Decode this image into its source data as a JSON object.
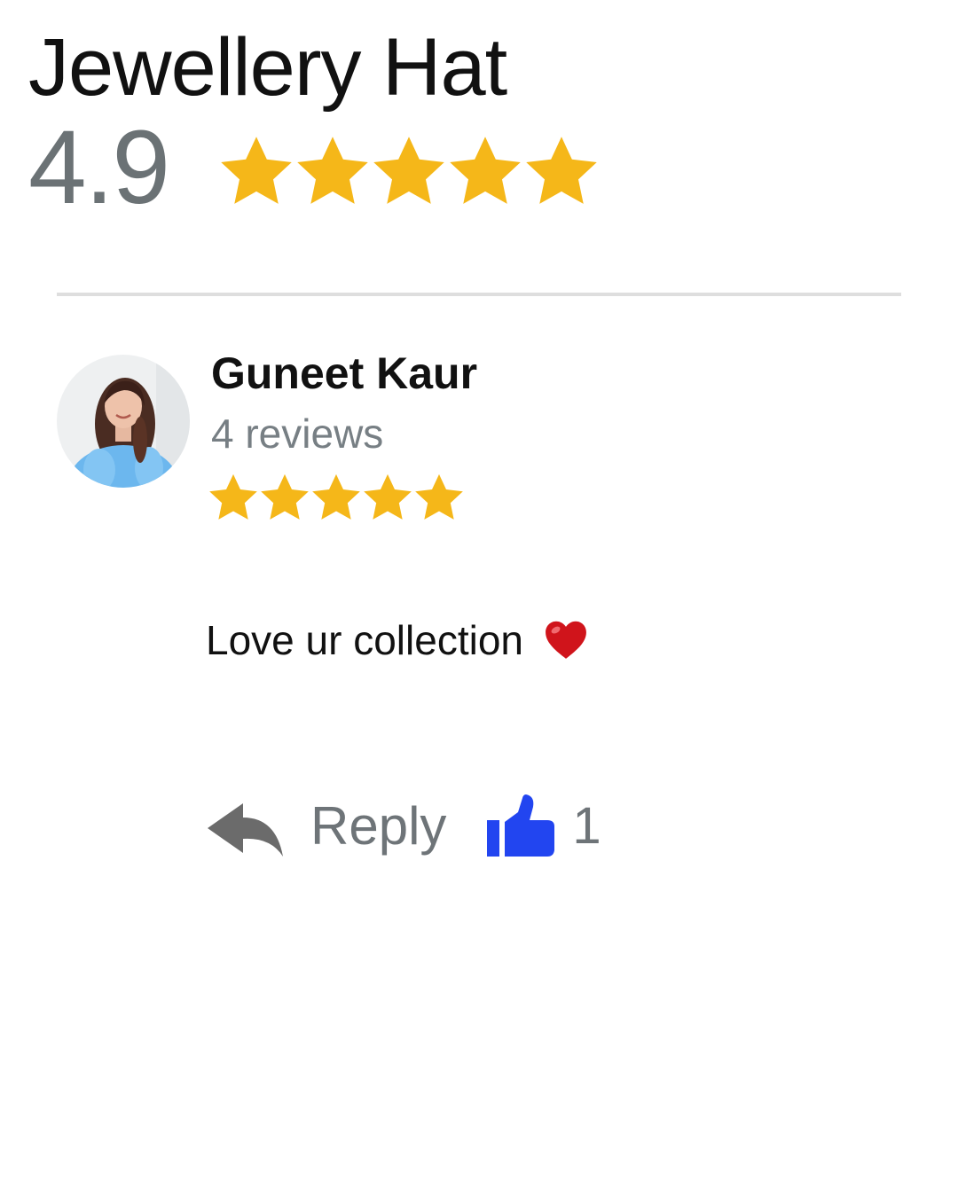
{
  "business": {
    "name": "Jewellery Hat",
    "rating": "4.9",
    "star_rating": 5,
    "star_color": "#F5B719"
  },
  "review": {
    "author": "Guneet Kaur",
    "review_count": "4 reviews",
    "star_rating": 5,
    "text": "Love ur collection",
    "emoji": "heart-icon",
    "actions": {
      "reply_label": "Reply",
      "like_count": "1"
    }
  },
  "colors": {
    "like_icon": "#2245F0",
    "reply_icon": "#6b6b6b",
    "heart": "#D0141B",
    "divider": "#DEDEDE"
  }
}
